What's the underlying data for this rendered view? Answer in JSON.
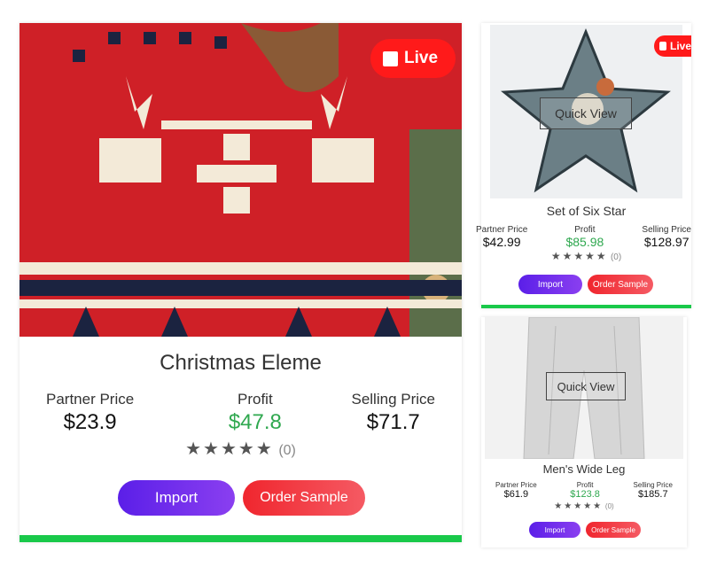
{
  "products": [
    {
      "title": "Christmas Eleme",
      "live_label": "Live",
      "partner_label": "Partner Price",
      "partner_value": "$23.9",
      "profit_label": "Profit",
      "profit_value": "$47.8",
      "selling_label": "Selling Price",
      "selling_value": "$71.7",
      "rating_count": "(0)",
      "import_label": "Import",
      "order_label": "Order Sample"
    },
    {
      "title": "Set of Six Star",
      "live_label": "Live",
      "quick_view": "Quick View",
      "partner_label": "Partner Price",
      "partner_value": "$42.99",
      "profit_label": "Profit",
      "profit_value": "$85.98",
      "selling_label": "Selling Price",
      "selling_value": "$128.97",
      "rating_count": "(0)",
      "import_label": "Import",
      "order_label": "Order Sample"
    },
    {
      "title": "Men's Wide Leg",
      "quick_view": "Quick View",
      "partner_label": "Partner Price",
      "partner_value": "$61.9",
      "profit_label": "Profit",
      "profit_value": "$123.8",
      "selling_label": "Selling Price",
      "selling_value": "$185.7",
      "rating_count": "(0)",
      "import_label": "Import",
      "order_label": "Order Sample"
    }
  ],
  "colors": {
    "live": "#ff1a1a",
    "profit": "#2fa84f",
    "import": "#5b1fe8",
    "order": "#f0262e",
    "bar": "#19c94a"
  },
  "icons": [
    "star-icon",
    "live-square-icon"
  ]
}
